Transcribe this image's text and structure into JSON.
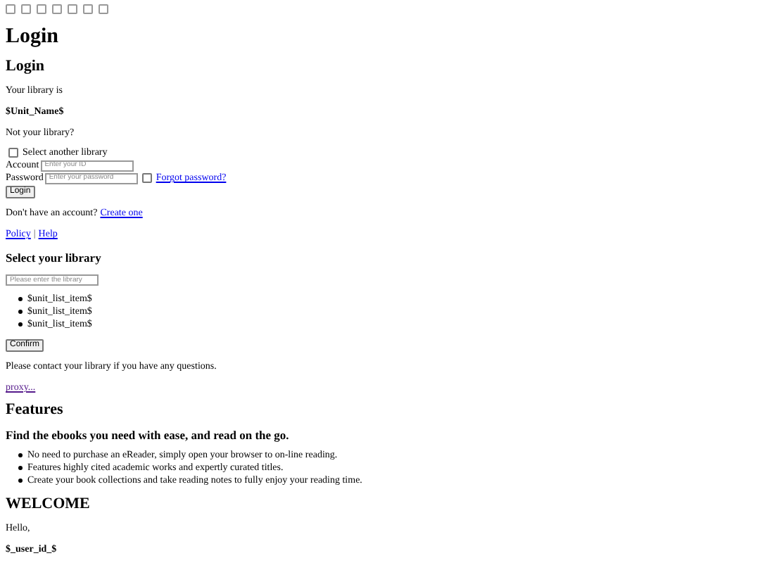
{
  "top_icons": [
    {
      "checked": false
    },
    {
      "checked": false
    },
    {
      "checked": false
    },
    {
      "checked": false
    },
    {
      "checked": false
    },
    {
      "checked": false
    },
    {
      "checked": false
    }
  ],
  "page_title": "Login",
  "login": {
    "heading": "Login",
    "library_label": "Your library is",
    "unit_name": "$Unit_Name$",
    "not_your_library": "Not your library?",
    "select_another": {
      "label": "Select another library",
      "checked": false
    },
    "account": {
      "label": "Account",
      "placeholder": "Enter your ID"
    },
    "password": {
      "label": "Password",
      "placeholder": "Enter your password"
    },
    "remember": {
      "checked": false
    },
    "forgot_link": "Forgot password?",
    "login_button": "Login",
    "no_account": "Don't have an account?",
    "create_link": "Create one",
    "policy_link": "Policy",
    "separator": "|",
    "help_link": "Help"
  },
  "select_library": {
    "heading": "Select your library",
    "search": {
      "placeholder": "Please enter the library"
    },
    "items": [
      "$unit_list_item$",
      "$unit_list_item$",
      "$unit_list_item$"
    ],
    "confirm_button": "Confirm",
    "contact_note": "Please contact your library if you have any questions.",
    "proxy_link": "proxy..."
  },
  "features": {
    "heading": "Features",
    "subheading": "Find the ebooks you need with ease, and read on the go.",
    "items": [
      "No need to purchase an eReader, simply open your browser to on-line reading.",
      "Features highly cited academic works and expertly curated titles.",
      "Create your book collections and take reading notes to fully enjoy your reading time."
    ]
  },
  "welcome": {
    "heading": "WELCOME",
    "greeting": "Hello,",
    "user_id": "$_user_id_$"
  }
}
